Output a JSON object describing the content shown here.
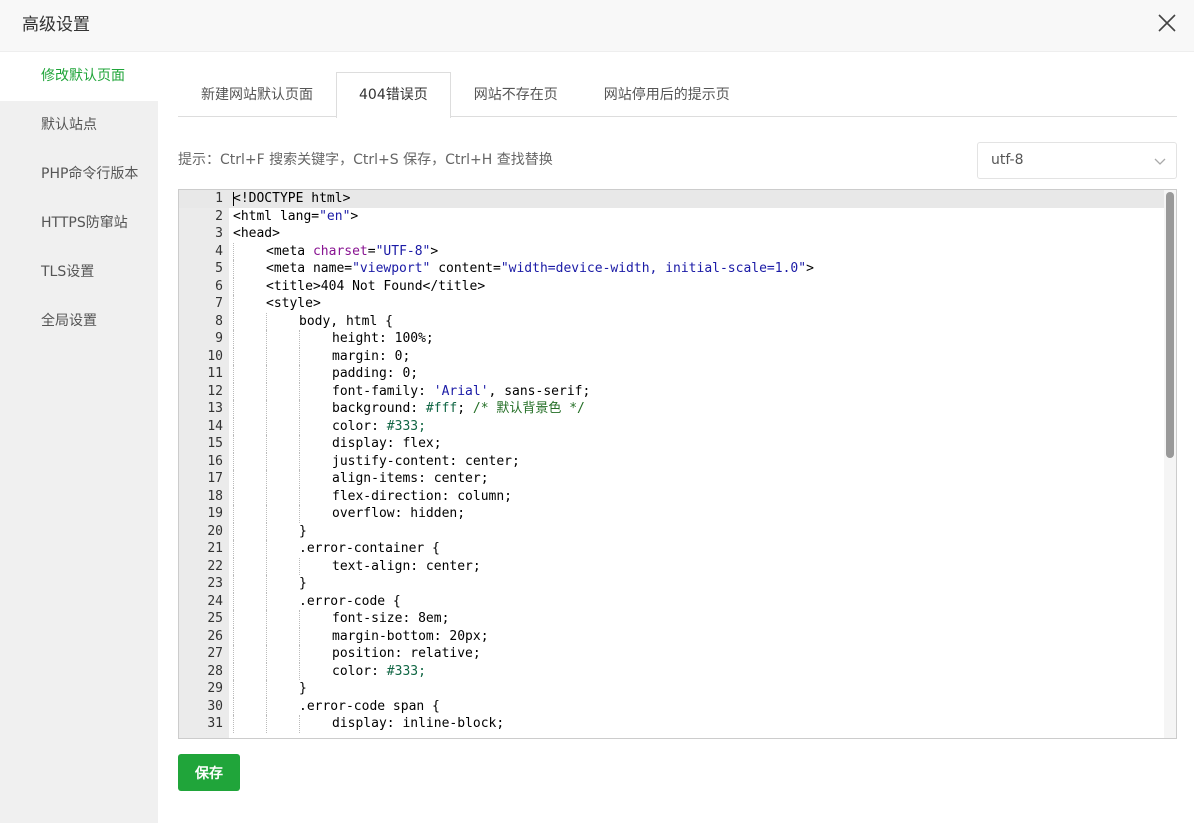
{
  "dialog": {
    "title": "高级设置"
  },
  "sidebar": {
    "items": [
      {
        "label": "修改默认页面",
        "active": true
      },
      {
        "label": "默认站点",
        "active": false
      },
      {
        "label": "PHP命令行版本",
        "active": false
      },
      {
        "label": "HTTPS防窜站",
        "active": false
      },
      {
        "label": "TLS设置",
        "active": false
      },
      {
        "label": "全局设置",
        "active": false
      }
    ]
  },
  "tabs": [
    {
      "label": "新建网站默认页面",
      "active": false
    },
    {
      "label": "404错误页",
      "active": true
    },
    {
      "label": "网站不存在页",
      "active": false
    },
    {
      "label": "网站停用后的提示页",
      "active": false
    }
  ],
  "hint": "提示：Ctrl+F 搜索关键字，Ctrl+S 保存，Ctrl+H 查找替换",
  "encoding": {
    "selected": "utf-8"
  },
  "editor": {
    "current_line": 1,
    "lines": [
      {
        "n": 1,
        "indent": 0,
        "parts": [
          [
            "",
            "<!DOCTYPE html>"
          ]
        ]
      },
      {
        "n": 2,
        "indent": 0,
        "parts": [
          [
            "",
            "<html lang="
          ],
          [
            "str",
            "\"en\""
          ],
          [
            "",
            ">"
          ]
        ]
      },
      {
        "n": 3,
        "indent": 0,
        "parts": [
          [
            "",
            "<head>"
          ]
        ]
      },
      {
        "n": 4,
        "indent": 1,
        "parts": [
          [
            "",
            "<meta "
          ],
          [
            "attr",
            "charset"
          ],
          [
            "",
            "="
          ],
          [
            "str",
            "\"UTF-8\""
          ],
          [
            "",
            ">"
          ]
        ]
      },
      {
        "n": 5,
        "indent": 1,
        "parts": [
          [
            "",
            "<meta name="
          ],
          [
            "str",
            "\"viewport\""
          ],
          [
            "",
            " content="
          ],
          [
            "str",
            "\"width=device-width, initial-scale=1.0\""
          ],
          [
            "",
            ">"
          ]
        ]
      },
      {
        "n": 6,
        "indent": 1,
        "parts": [
          [
            "",
            "<title>404 Not Found</title>"
          ]
        ]
      },
      {
        "n": 7,
        "indent": 1,
        "parts": [
          [
            "",
            "<style>"
          ]
        ]
      },
      {
        "n": 8,
        "indent": 2,
        "parts": [
          [
            "",
            "body, html {"
          ]
        ]
      },
      {
        "n": 9,
        "indent": 3,
        "parts": [
          [
            "",
            "height: 100%;"
          ]
        ]
      },
      {
        "n": 10,
        "indent": 3,
        "parts": [
          [
            "",
            "margin: 0;"
          ]
        ]
      },
      {
        "n": 11,
        "indent": 3,
        "parts": [
          [
            "",
            "padding: 0;"
          ]
        ]
      },
      {
        "n": 12,
        "indent": 3,
        "parts": [
          [
            "",
            "font-family: "
          ],
          [
            "str",
            "'Arial'"
          ],
          [
            "",
            ", sans-serif;"
          ]
        ]
      },
      {
        "n": 13,
        "indent": 3,
        "parts": [
          [
            "",
            "background: "
          ],
          [
            "num",
            "#fff"
          ],
          [
            "",
            "; "
          ],
          [
            "com",
            "/* 默认背景色 */"
          ]
        ]
      },
      {
        "n": 14,
        "indent": 3,
        "parts": [
          [
            "",
            "color: "
          ],
          [
            "num",
            "#333;"
          ]
        ]
      },
      {
        "n": 15,
        "indent": 3,
        "parts": [
          [
            "",
            "display: flex;"
          ]
        ]
      },
      {
        "n": 16,
        "indent": 3,
        "parts": [
          [
            "",
            "justify-content: center;"
          ]
        ]
      },
      {
        "n": 17,
        "indent": 3,
        "parts": [
          [
            "",
            "align-items: center;"
          ]
        ]
      },
      {
        "n": 18,
        "indent": 3,
        "parts": [
          [
            "",
            "flex-direction: column;"
          ]
        ]
      },
      {
        "n": 19,
        "indent": 3,
        "parts": [
          [
            "",
            "overflow: hidden;"
          ]
        ]
      },
      {
        "n": 20,
        "indent": 2,
        "parts": [
          [
            "",
            "}"
          ]
        ]
      },
      {
        "n": 21,
        "indent": 2,
        "parts": [
          [
            "",
            ".error-container {"
          ]
        ]
      },
      {
        "n": 22,
        "indent": 3,
        "parts": [
          [
            "",
            "text-align: center;"
          ]
        ]
      },
      {
        "n": 23,
        "indent": 2,
        "parts": [
          [
            "",
            "}"
          ]
        ]
      },
      {
        "n": 24,
        "indent": 2,
        "parts": [
          [
            "",
            ".error-code {"
          ]
        ]
      },
      {
        "n": 25,
        "indent": 3,
        "parts": [
          [
            "",
            "font-size: 8em;"
          ]
        ]
      },
      {
        "n": 26,
        "indent": 3,
        "parts": [
          [
            "",
            "margin-bottom: 20px;"
          ]
        ]
      },
      {
        "n": 27,
        "indent": 3,
        "parts": [
          [
            "",
            "position: relative;"
          ]
        ]
      },
      {
        "n": 28,
        "indent": 3,
        "parts": [
          [
            "",
            "color: "
          ],
          [
            "num",
            "#333;"
          ]
        ]
      },
      {
        "n": 29,
        "indent": 2,
        "parts": [
          [
            "",
            "}"
          ]
        ]
      },
      {
        "n": 30,
        "indent": 2,
        "parts": [
          [
            "",
            ".error-code span {"
          ]
        ]
      },
      {
        "n": 31,
        "indent": 3,
        "parts": [
          [
            "",
            "display: inline-block;"
          ]
        ]
      }
    ]
  },
  "actions": {
    "save_label": "保存"
  },
  "colors": {
    "accent": "#20a53a",
    "sidebar_bg": "#f0f0f0",
    "gutter_bg": "#ebebeb"
  },
  "icons": {
    "close": "close-icon",
    "dropdown": "chevron-down-icon"
  }
}
